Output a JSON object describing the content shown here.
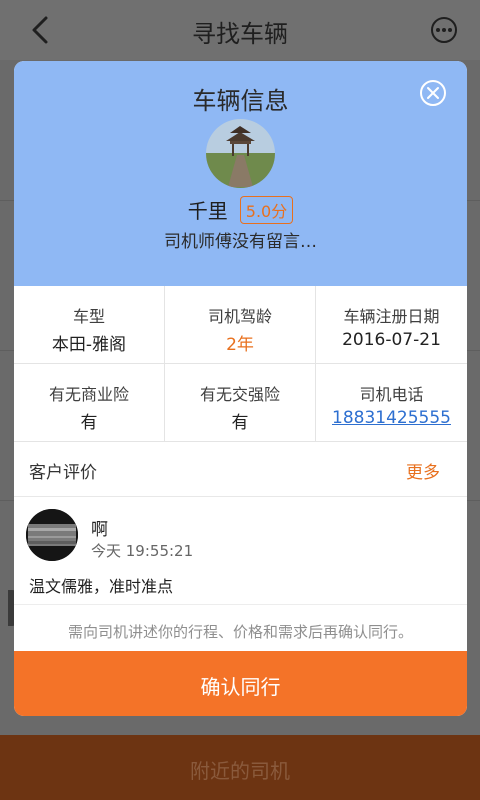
{
  "header": {
    "title": "寻找车辆"
  },
  "icons": {
    "back": "chevron-left-icon",
    "more": "more-dots-icon",
    "close": "close-circle-icon"
  },
  "bottom_bar": {
    "label": "附近的司机"
  },
  "modal": {
    "title": "车辆信息",
    "driver": {
      "name": "千里",
      "rating": "5.0分",
      "message": "司机师傅没有留言…"
    },
    "info": [
      {
        "label": "车型",
        "value": "本田-雅阁"
      },
      {
        "label": "司机驾龄",
        "value": "2年"
      },
      {
        "label": "车辆注册日期",
        "value": "2016-07-21"
      },
      {
        "label": "有无商业险",
        "value": "有"
      },
      {
        "label": "有无交强险",
        "value": "有"
      },
      {
        "label": "司机电话",
        "value": "18831425555"
      }
    ],
    "reviews": {
      "title": "客户评价",
      "more_label": "更多",
      "items": [
        {
          "name": "啊",
          "time": "今天 19:55:21",
          "text": "温文儒雅，准时准点"
        }
      ]
    },
    "notice": "需向司机讲述你的行程、价格和需求后再确认同行。",
    "confirm_label": "确认同行"
  },
  "colors": {
    "accent": "#f47328",
    "header_blue": "#8fb8f4",
    "link": "#2d6fd0"
  }
}
